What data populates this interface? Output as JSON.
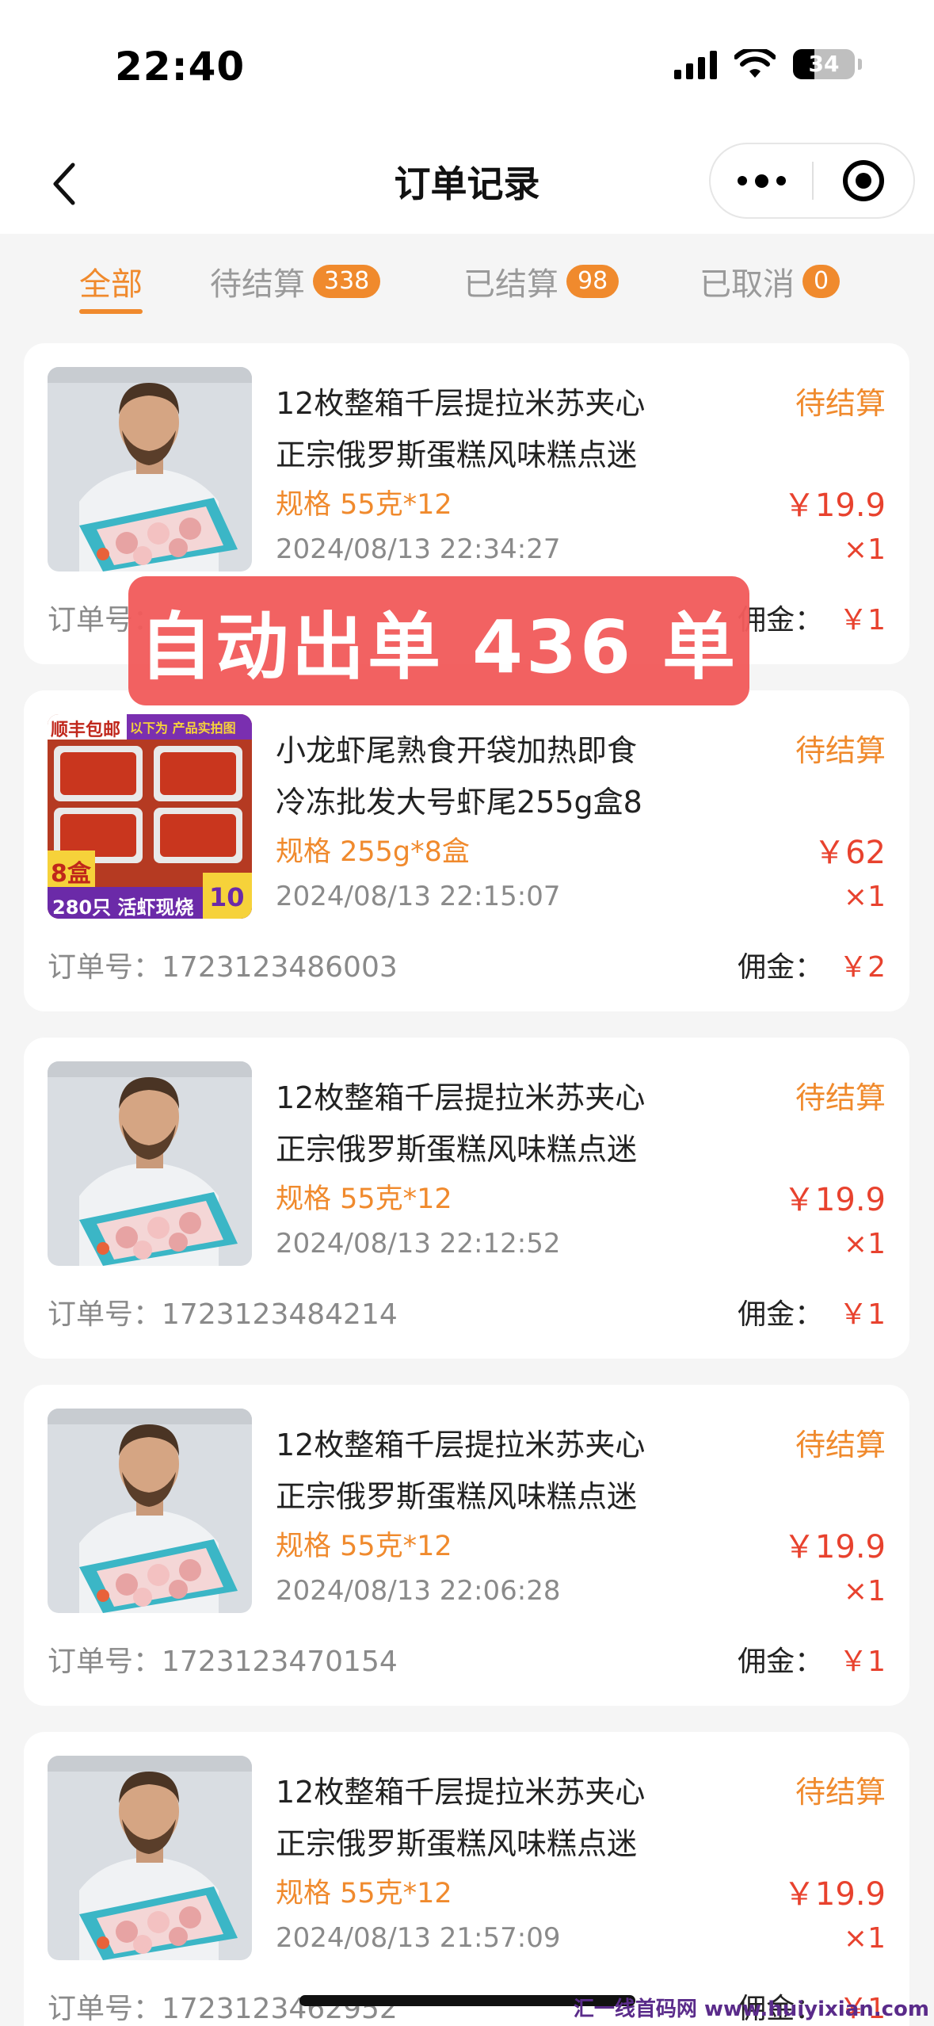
{
  "status_bar": {
    "time": "22:40",
    "battery": "34"
  },
  "nav": {
    "title": "订单记录"
  },
  "tabs": [
    {
      "label": "全部",
      "badge": ""
    },
    {
      "label": "待结算",
      "badge": "338"
    },
    {
      "label": "已结算",
      "badge": "98"
    },
    {
      "label": "已取消",
      "badge": "0"
    }
  ],
  "orders": [
    {
      "title_line1": "12枚整箱千层提拉米苏夹心",
      "title_line2": "正宗俄罗斯蛋糕风味糕点迷",
      "spec": "规格 55克*12",
      "date": "2024/08/13 22:34:27",
      "status": "待结算",
      "price": "￥19.9",
      "qty": "×1",
      "order_label": "订单号：",
      "order_no": "",
      "commission_label": "佣金：",
      "commission": "￥1",
      "image": "chef-cake-box"
    },
    {
      "title_line1": "小龙虾尾熟食开袋加热即食",
      "title_line2": "冷冻批发大号虾尾255g盒8",
      "spec": "规格 255g*8盒",
      "date": "2024/08/13 22:15:07",
      "status": "待结算",
      "price": "￥62",
      "qty": "×1",
      "order_label": "订单号：",
      "order_no": "1723123486003",
      "commission_label": "佣金：",
      "commission": "￥2",
      "image": "crayfish-boxes",
      "image_text": {
        "tag": "顺丰包邮",
        "promo": "以下为 产品实拍图",
        "count": "8盒",
        "bottom": "280只 活虾现烧",
        "price_hint": "10"
      }
    },
    {
      "title_line1": "12枚整箱千层提拉米苏夹心",
      "title_line2": "正宗俄罗斯蛋糕风味糕点迷",
      "spec": "规格 55克*12",
      "date": "2024/08/13 22:12:52",
      "status": "待结算",
      "price": "￥19.9",
      "qty": "×1",
      "order_label": "订单号：",
      "order_no": "1723123484214",
      "commission_label": "佣金：",
      "commission": "￥1",
      "image": "chef-cake-box"
    },
    {
      "title_line1": "12枚整箱千层提拉米苏夹心",
      "title_line2": "正宗俄罗斯蛋糕风味糕点迷",
      "spec": "规格 55克*12",
      "date": "2024/08/13 22:06:28",
      "status": "待结算",
      "price": "￥19.9",
      "qty": "×1",
      "order_label": "订单号：",
      "order_no": "1723123470154",
      "commission_label": "佣金：",
      "commission": "￥1",
      "image": "chef-cake-box"
    },
    {
      "title_line1": "12枚整箱千层提拉米苏夹心",
      "title_line2": "正宗俄罗斯蛋糕风味糕点迷",
      "spec": "规格 55克*12",
      "date": "2024/08/13 21:57:09",
      "status": "待结算",
      "price": "￥19.9",
      "qty": "×1",
      "order_label": "订单号：",
      "order_no": "1723123462952",
      "commission_label": "佣金：",
      "commission": "￥1",
      "image": "chef-cake-box"
    }
  ],
  "overlay": {
    "text": "自动出单 436 单"
  },
  "watermark": "汇一线首码网 www.huiyixian.com",
  "colors": {
    "accent": "#f08a2d",
    "price": "#e8422e",
    "banner": "#f25c5c"
  }
}
